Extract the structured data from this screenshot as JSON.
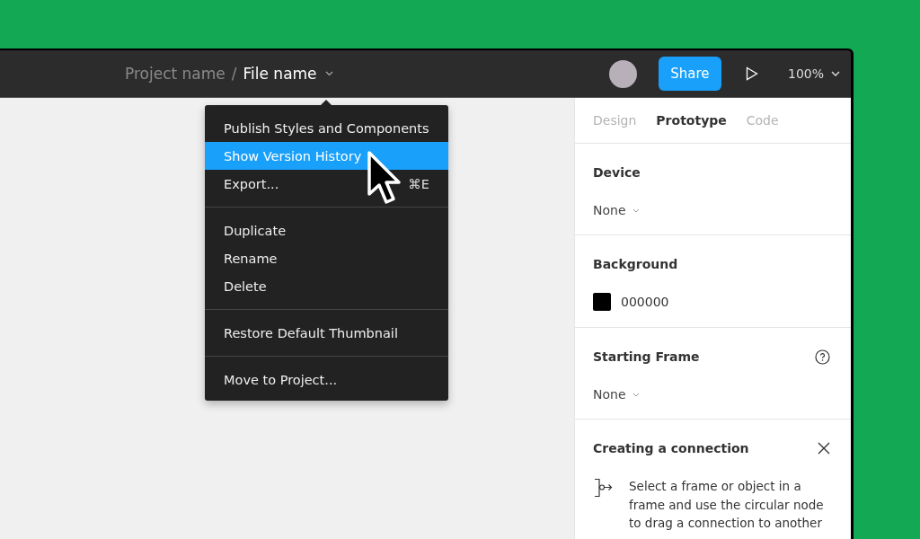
{
  "toolbar": {
    "project_name": "Project name",
    "separator": "/",
    "file_name": "File name",
    "share_button": "Share",
    "zoom": "100%"
  },
  "file_menu": {
    "groups": [
      [
        {
          "label": "Publish Styles and Components",
          "selected": false
        },
        {
          "label": "Show Version History",
          "selected": true
        },
        {
          "label": "Export...",
          "selected": false,
          "shortcut": "⌘E"
        }
      ],
      [
        {
          "label": "Duplicate",
          "selected": false
        },
        {
          "label": "Rename",
          "selected": false
        },
        {
          "label": "Delete",
          "selected": false
        }
      ],
      [
        {
          "label": "Restore Default Thumbnail",
          "selected": false
        }
      ],
      [
        {
          "label": "Move to Project...",
          "selected": false
        }
      ]
    ]
  },
  "panel": {
    "tabs": [
      {
        "label": "Design",
        "selected": false
      },
      {
        "label": "Prototype",
        "selected": true
      },
      {
        "label": "Code",
        "selected": false
      }
    ],
    "sections": [
      {
        "kind": "dropdown",
        "title": "Device",
        "value": "None"
      },
      {
        "kind": "color",
        "title": "Background",
        "value": "000000",
        "color": "#000000"
      },
      {
        "kind": "dropdown",
        "title": "Starting Frame",
        "value": "None",
        "help": true
      },
      {
        "kind": "hint",
        "title": "Creating a connection",
        "text": "Select a frame or object in a frame and use the circular node to drag a connection to another"
      }
    ]
  }
}
